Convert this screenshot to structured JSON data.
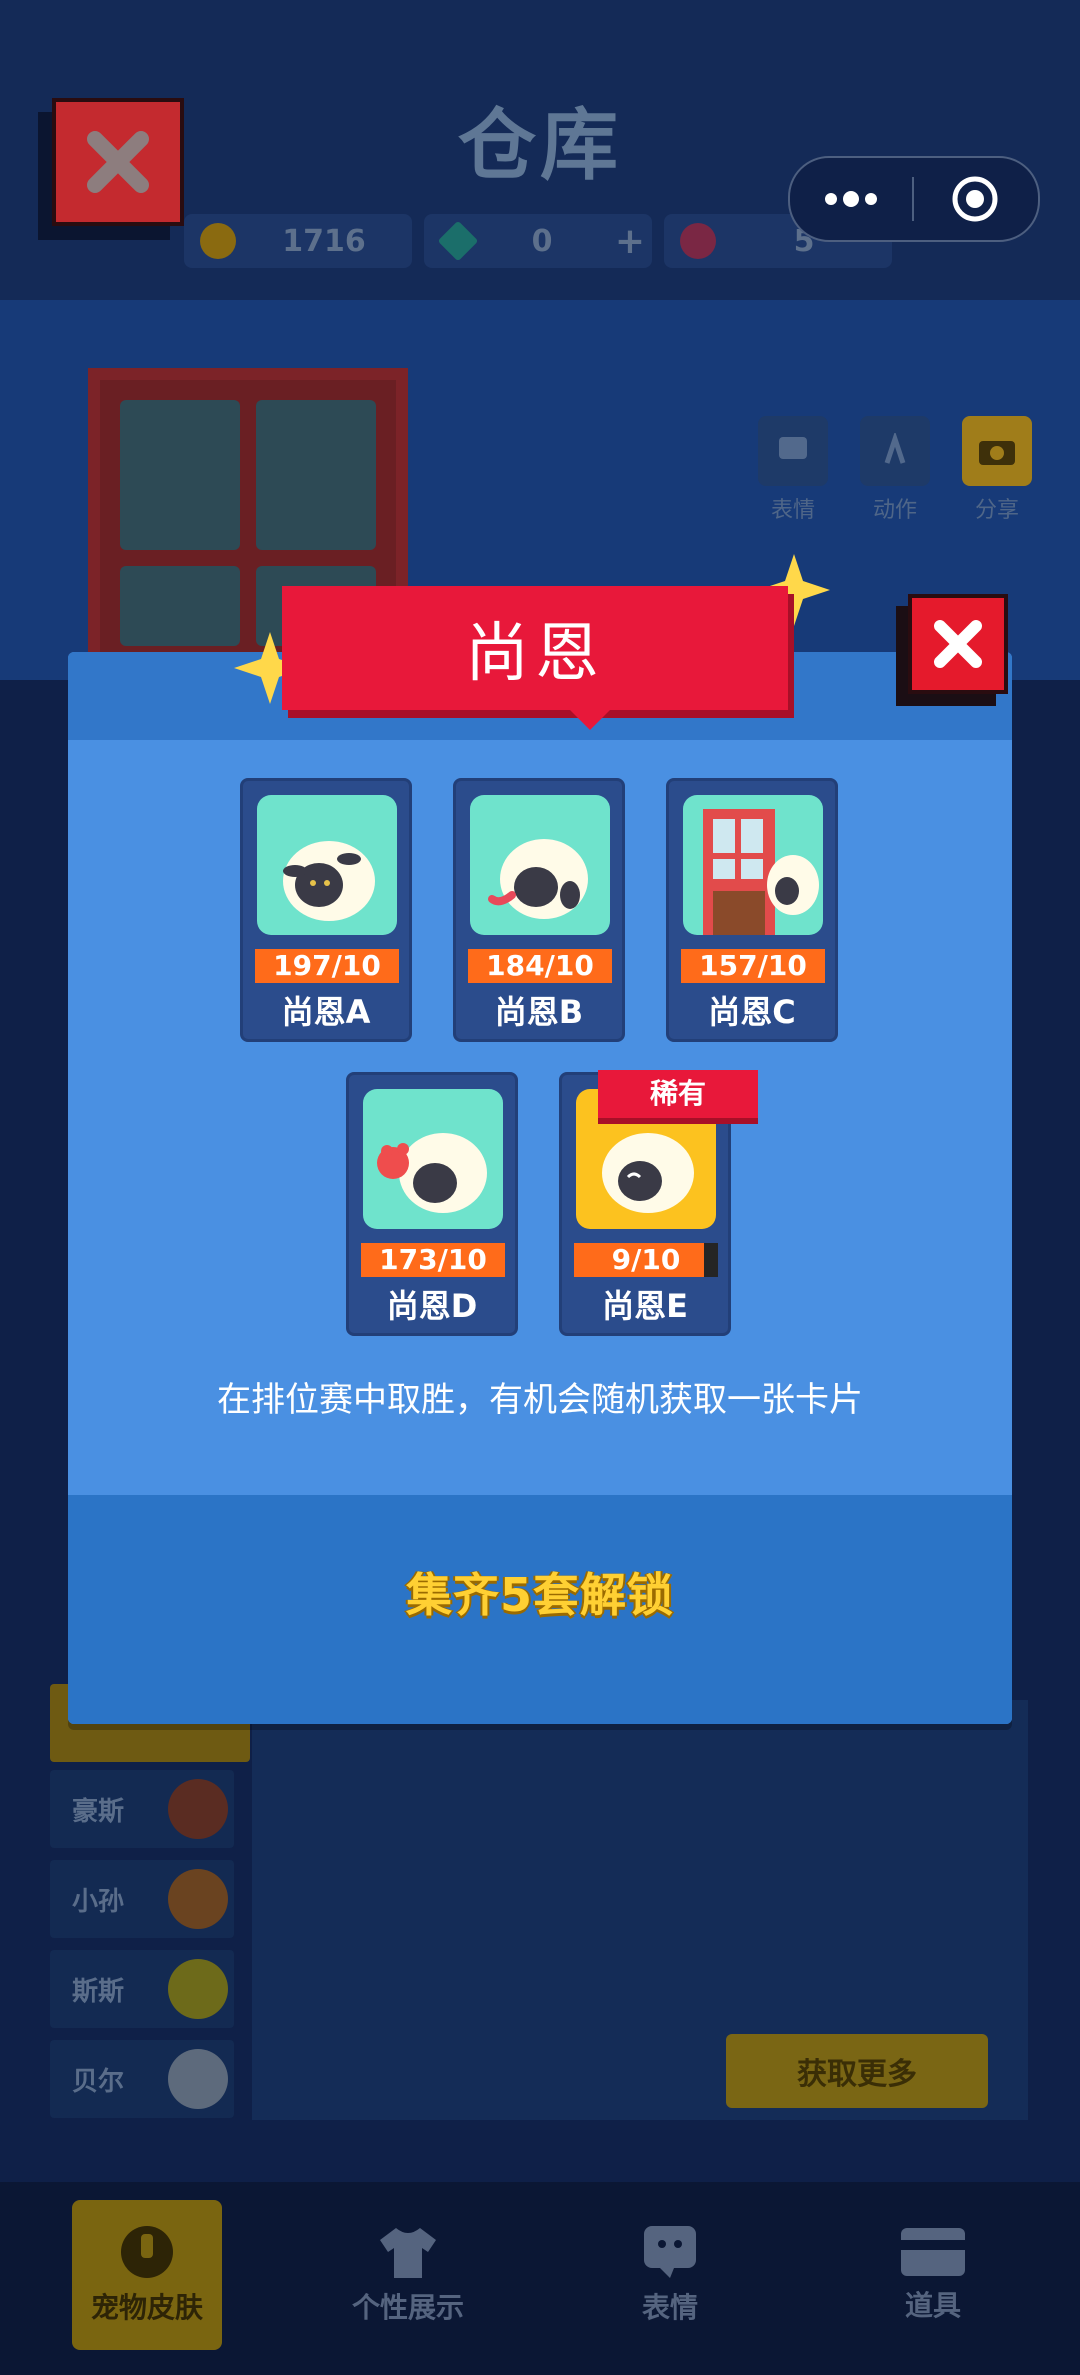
{
  "page": {
    "title": "仓库",
    "currencies": [
      {
        "name": "coin",
        "value": "1716",
        "color": "#ffc107"
      },
      {
        "name": "gem",
        "value": "0",
        "color": "#1fc9b3"
      },
      {
        "name": "ticket",
        "value": "5",
        "color": "#e8336b"
      }
    ],
    "add_symbol": "+",
    "actions": [
      {
        "label": "表情",
        "icon": "emoji-icon"
      },
      {
        "label": "动作",
        "icon": "action-icon"
      },
      {
        "label": "分享",
        "icon": "camera-icon"
      }
    ],
    "pet_list": [
      {
        "name": "豪斯"
      },
      {
        "name": "小孙"
      },
      {
        "name": "斯斯"
      },
      {
        "name": "贝尔"
      }
    ],
    "get_more_label": "获取更多",
    "nav": [
      {
        "label": "宠物皮肤",
        "icon": "pet-icon",
        "active": true
      },
      {
        "label": "个性展示",
        "icon": "shirt-icon",
        "active": false
      },
      {
        "label": "表情",
        "icon": "emoji-icon",
        "active": false
      },
      {
        "label": "道具",
        "icon": "card-icon",
        "active": false
      }
    ]
  },
  "modal": {
    "title": "尚恩",
    "cards": [
      {
        "name": "尚恩A",
        "count": "197/10",
        "progress": 1.0,
        "rare": false
      },
      {
        "name": "尚恩B",
        "count": "184/10",
        "progress": 1.0,
        "rare": false
      },
      {
        "name": "尚恩C",
        "count": "157/10",
        "progress": 1.0,
        "rare": false
      },
      {
        "name": "尚恩D",
        "count": "173/10",
        "progress": 1.0,
        "rare": false
      },
      {
        "name": "尚恩E",
        "count": "9/10",
        "progress": 0.9,
        "rare": true
      }
    ],
    "rare_label": "稀有",
    "hint": "在排位赛中取胜，有机会随机获取一张卡片",
    "unlock_label": "集齐5套解锁"
  },
  "colors": {
    "ribbon": "#e8183a",
    "modal_body": "#4a90e2",
    "count_bar": "#ff6b1a",
    "unlock_text": "#ffd033",
    "nav_active": "#7a6510"
  }
}
